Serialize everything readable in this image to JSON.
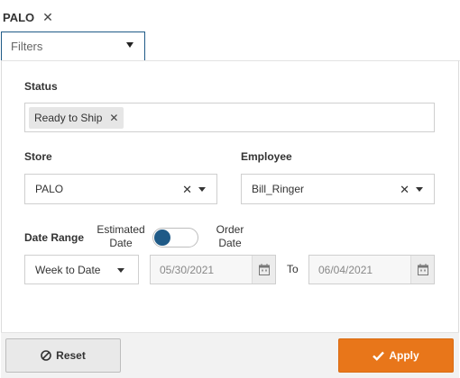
{
  "top_chip": {
    "label": "PALO",
    "close_glyph": "✕"
  },
  "filters_dropdown": {
    "label": "Filters"
  },
  "status": {
    "label": "Status",
    "tags": [
      {
        "label": "Ready to Ship",
        "remove_glyph": "✕"
      }
    ]
  },
  "store": {
    "label": "Store",
    "value": "PALO",
    "clear_glyph": "✕"
  },
  "employee": {
    "label": "Employee",
    "value": "Bill_Ringer",
    "clear_glyph": "✕"
  },
  "date_range": {
    "label": "Date Range",
    "toggle_left_label": "Estimated\nDate",
    "toggle_right_label": "Order\nDate",
    "toggle_on_left": true,
    "preset": "Week to Date",
    "from_date": "05/30/2021",
    "to_label": "To",
    "to_date": "06/04/2021"
  },
  "actions": {
    "reset_label": "Reset",
    "apply_label": "Apply"
  },
  "colors": {
    "accent_blue": "#1f5a87",
    "apply_orange": "#e8761a",
    "footer_bg": "#f2f2f2"
  },
  "icons": {
    "chip_close": "close-icon",
    "filters_caret": "chevron-down-icon",
    "calendar": "calendar-icon",
    "reset": "reset-circle-icon",
    "apply": "check-icon"
  }
}
